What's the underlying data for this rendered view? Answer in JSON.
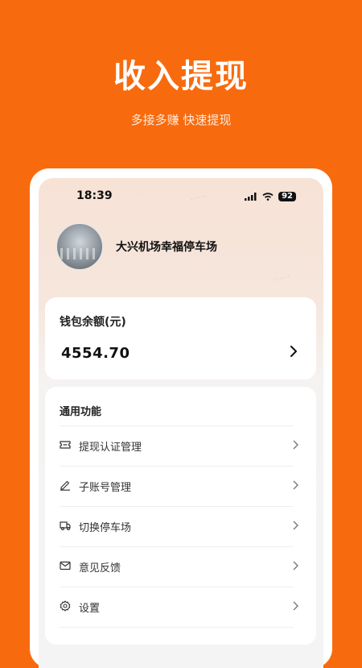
{
  "promo": {
    "title": "收入提现",
    "subtitle": "多接多赚 快速提现"
  },
  "status_bar": {
    "time": "18:39",
    "battery": "92"
  },
  "profile": {
    "lot_name": "大兴机场幸福停车场"
  },
  "wallet": {
    "label": "钱包余额(元)",
    "amount": "4554.70"
  },
  "functions": {
    "title": "通用功能",
    "items": [
      {
        "label": "提现认证管理",
        "icon": "ticket-icon"
      },
      {
        "label": "子账号管理",
        "icon": "edit-icon"
      },
      {
        "label": "切换停车场",
        "icon": "truck-icon"
      },
      {
        "label": "意见反馈",
        "icon": "mail-icon"
      },
      {
        "label": "设置",
        "icon": "gear-icon"
      }
    ]
  },
  "colors": {
    "brand": "#F76B0E",
    "card": "#FFFFFF"
  }
}
